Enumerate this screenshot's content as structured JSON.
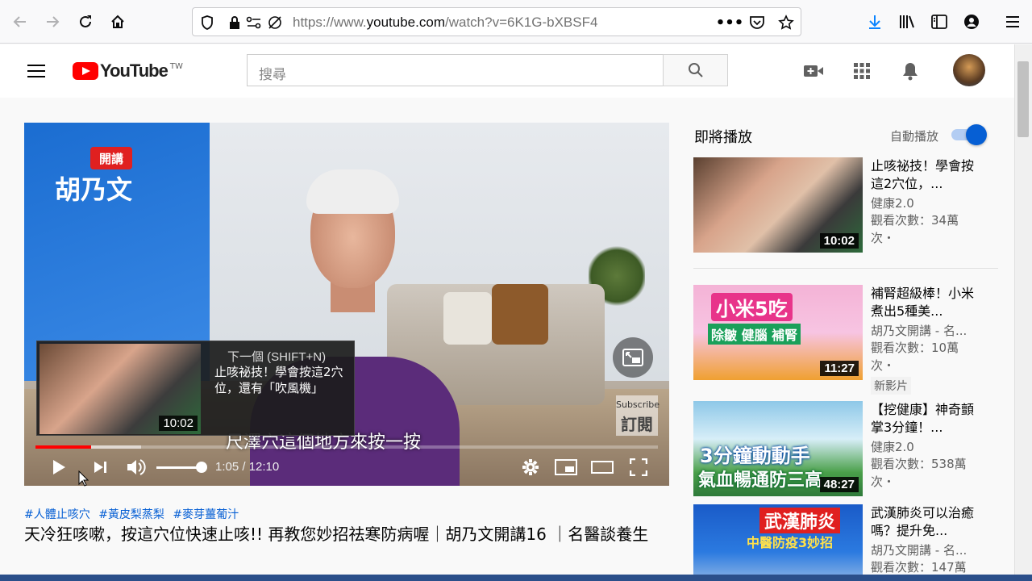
{
  "browser": {
    "url_prefix": "https://www.",
    "url_domain": "youtube.com",
    "url_path": "/watch?v=6K1G-bXBSF4"
  },
  "header": {
    "logo_text": "YouTube",
    "region": "TW",
    "search_placeholder": "搜尋"
  },
  "player": {
    "show_badge": "開講",
    "show_name": "胡乃文",
    "subtitle": "尺澤穴這個地方來按一按",
    "subscribe_en": "Subscribe",
    "subscribe_zh": "訂閱",
    "next_label": "下一個 (SHIFT+N)",
    "next_title": "止咳祕技！學會按這2穴位，還有「吹風機」",
    "next_duration": "10:02",
    "time_display": "1:05 / 12:10",
    "progress_fraction": 0.089,
    "buffered_fraction": 0.17,
    "volume_fraction": 1.0
  },
  "video": {
    "hashtags": [
      "#人體止咳穴",
      "#黃皮梨蒸梨",
      "#麥芽薑葡汁"
    ],
    "title": "天冷狂咳嗽，按這穴位快速止咳!! 再教您妙招祛寒防病喔｜胡乃文開講16 ｜名醫談養生"
  },
  "sidebar": {
    "up_next": "即將播放",
    "autoplay": "自動播放",
    "autoplay_on": true,
    "items": [
      {
        "title": "止咳祕技！學會按這2穴位，...",
        "channel": "健康2.0",
        "views": "觀看次數：34萬次・",
        "duration": "10:02",
        "badge": ""
      },
      {
        "title": "補腎超級棒！小米煮出5種美...",
        "channel": "胡乃文開講 - 名...",
        "views": "觀看次數：10萬次・",
        "duration": "11:27",
        "badge": "新影片",
        "thumb_text_1": "小米5吃",
        "thumb_text_2": "除皺 健腦 補腎"
      },
      {
        "title": "【挖健康】神奇顫掌3分鐘！...",
        "channel": "健康2.0",
        "views": "觀看次數：538萬次・",
        "duration": "48:27",
        "badge": "",
        "thumb_text_1": "3分鐘動動手",
        "thumb_text_2": "氣血暢通防三高"
      },
      {
        "title": "武漢肺炎可以治癒嗎？提升免...",
        "channel": "胡乃文開講 - 名...",
        "views": "觀看次數：147萬",
        "duration": "",
        "badge": "",
        "thumb_text_1": "武漢肺炎",
        "thumb_text_2": "中醫防疫3妙招"
      }
    ]
  },
  "colors": {
    "yt_red": "#ff0000",
    "link_blue": "#065fd4",
    "text_secondary": "#606060"
  }
}
